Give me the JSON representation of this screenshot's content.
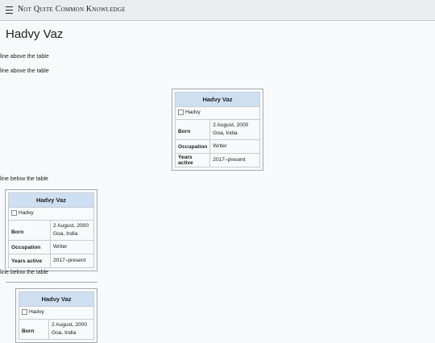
{
  "header": {
    "site_title": "Not Quite Common Knowledge",
    "menu_icon": "hamburger-icon"
  },
  "page": {
    "title": "Hadvy Vaz"
  },
  "lines": {
    "above_1": "line above the table",
    "above_2": "line above the table",
    "below_1": "line below the table",
    "below_2": "line below the table"
  },
  "infobox": {
    "title": "Hadvy Vaz",
    "image_alt": "Hadvy",
    "rows": [
      {
        "label": "Born",
        "value_line1": "2 August, 2000",
        "value_line2": "Goa, India"
      },
      {
        "label": "Occupation",
        "value": "Writer"
      },
      {
        "label": "Years active",
        "value": "2017–present"
      }
    ]
  },
  "colors": {
    "header_bg": "#cedff2",
    "topbar_bg": "#eaecf0",
    "border": "#a2a9b1"
  }
}
